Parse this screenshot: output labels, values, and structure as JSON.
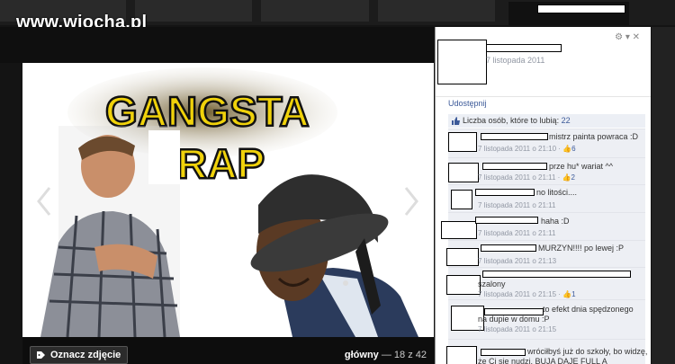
{
  "watermark": "www.wiocha.pl",
  "photo": {
    "title_line1": "GANGSTA",
    "title_line2": "RAP"
  },
  "bottom_bar": {
    "tag_label": "Oznacz zdjęcie",
    "album": "główny",
    "position": "— 18 z 42"
  },
  "panel": {
    "settings": "⚙ ▾  ✕",
    "date": "7 listopada 2011",
    "share": "Udostępnij",
    "likes_label": "Liczba osób, które to lubią:",
    "likes_count": "22",
    "comments": [
      {
        "text": "mistrz painta powraca :D",
        "date": "7 listopada 2011 o 21:10 ·",
        "likes": "6"
      },
      {
        "text": "prze hu* wariat ^^",
        "date": "7 listopada 2011 o 21:11 ·",
        "likes": "2"
      },
      {
        "text": "no litości....",
        "date": "7 listopada 2011 o 21:11",
        "likes": ""
      },
      {
        "text": "haha :D",
        "date": "7 listopada 2011 o 21:11",
        "likes": ""
      },
      {
        "text": "MURZYN!!!! po lewej :P",
        "date": "7 listopada 2011 o 21:13",
        "likes": ""
      },
      {
        "text": "szalony",
        "date": "7 listopada 2011 o 21:15 ·",
        "likes": "1"
      },
      {
        "text": "to efekt dnia spędzonego",
        "text2": "na dupie w domu :P",
        "date": "7 listopada 2011 o 21:15",
        "likes": ""
      },
      {
        "text": "wróciłbyś już do szkoły, bo widzę,",
        "text2": "że Ci się nudzi. BUJA DAJE FULL A",
        "date": "",
        "likes": ""
      }
    ]
  }
}
